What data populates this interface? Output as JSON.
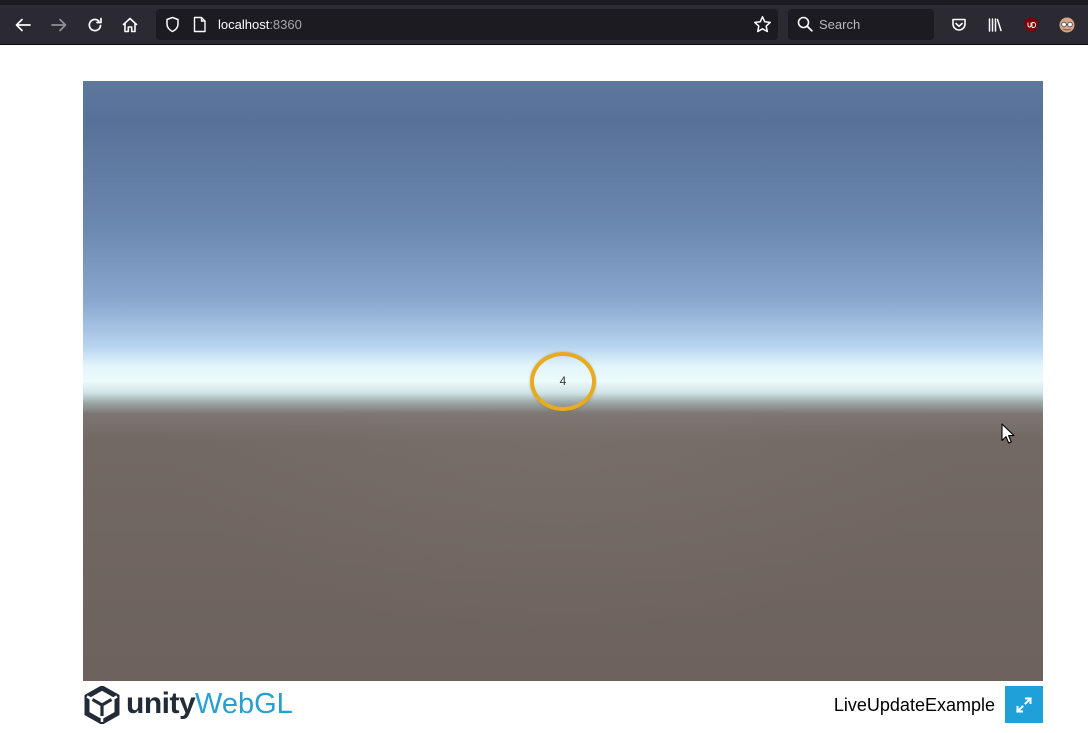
{
  "browser": {
    "url_host": "localhost",
    "url_port": ":8360",
    "search_placeholder": "Search",
    "icons": {
      "back": "arrow-left-icon",
      "forward": "arrow-right-icon",
      "reload": "reload-icon",
      "home": "home-icon",
      "tracking": "shield-icon",
      "page": "page-icon",
      "bookmark": "star-icon",
      "search": "search-icon",
      "pocket": "pocket-icon",
      "library": "library-icon",
      "ublock": "ublock-icon",
      "extension": "extension-icon"
    }
  },
  "game": {
    "ring_label": "4",
    "colors": {
      "ring": "#e8aa1f",
      "sky_top": "#587198",
      "horizon": "#ecfbfb",
      "ground": "#6d625d"
    }
  },
  "footer": {
    "logo_unity": "unity",
    "logo_webgl": "WebGL",
    "title": "LiveUpdateExample",
    "colors": {
      "webgl": "#26a0d1",
      "fullscreen_bg": "#1fa0d8"
    }
  }
}
